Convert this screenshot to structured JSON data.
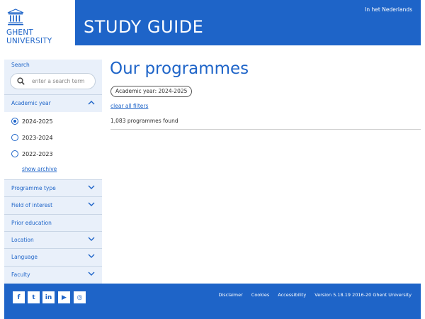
{
  "header": {
    "university_line1": "GHENT",
    "university_line2": "UNIVERSITY",
    "title": "STUDY GUIDE",
    "language_link": "In het Nederlands"
  },
  "sidebar": {
    "search_label": "Search",
    "search_placeholder": "enter a search term",
    "academic_year": {
      "label": "Academic year",
      "options": [
        {
          "label": "2024-2025",
          "selected": true
        },
        {
          "label": "2023-2024",
          "selected": false
        },
        {
          "label": "2022-2023",
          "selected": false
        }
      ],
      "archive_link": "show archive"
    },
    "filters": [
      {
        "label": "Programme type",
        "chevron": true
      },
      {
        "label": "Field of interest",
        "chevron": true
      },
      {
        "label": "Prior education",
        "chevron": false
      },
      {
        "label": "Location",
        "chevron": true
      },
      {
        "label": "Language",
        "chevron": true
      },
      {
        "label": "Faculty",
        "chevron": true
      }
    ]
  },
  "main": {
    "title": "Our programmes",
    "active_filter": "Academic year: 2024-2025",
    "clear_filters": "clear all filters",
    "results_count": "1,083 programmes found"
  },
  "footer": {
    "social": [
      {
        "icon": "facebook-icon",
        "glyph": "f"
      },
      {
        "icon": "twitter-icon",
        "glyph": "t"
      },
      {
        "icon": "linkedin-icon",
        "glyph": "in"
      },
      {
        "icon": "youtube-icon",
        "glyph": "▶"
      },
      {
        "icon": "instagram-icon",
        "glyph": "◎"
      }
    ],
    "links": [
      "Disclaimer",
      "Cookies",
      "Accessibility"
    ],
    "version": "Version 5.18.19  2016-20 Ghent University"
  },
  "colors": {
    "brand_blue": "#1e64c8",
    "sidebar_bg": "#e9f0fa"
  }
}
